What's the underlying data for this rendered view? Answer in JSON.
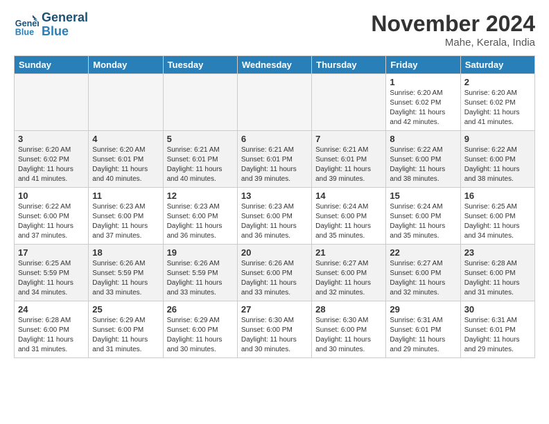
{
  "logo": {
    "line1": "General",
    "line2": "Blue"
  },
  "title": "November 2024",
  "location": "Mahe, Kerala, India",
  "days_of_week": [
    "Sunday",
    "Monday",
    "Tuesday",
    "Wednesday",
    "Thursday",
    "Friday",
    "Saturday"
  ],
  "weeks": [
    {
      "shaded": false,
      "days": [
        {
          "num": "",
          "detail": ""
        },
        {
          "num": "",
          "detail": ""
        },
        {
          "num": "",
          "detail": ""
        },
        {
          "num": "",
          "detail": ""
        },
        {
          "num": "",
          "detail": ""
        },
        {
          "num": "1",
          "detail": "Sunrise: 6:20 AM\nSunset: 6:02 PM\nDaylight: 11 hours\nand 42 minutes."
        },
        {
          "num": "2",
          "detail": "Sunrise: 6:20 AM\nSunset: 6:02 PM\nDaylight: 11 hours\nand 41 minutes."
        }
      ]
    },
    {
      "shaded": true,
      "days": [
        {
          "num": "3",
          "detail": "Sunrise: 6:20 AM\nSunset: 6:02 PM\nDaylight: 11 hours\nand 41 minutes."
        },
        {
          "num": "4",
          "detail": "Sunrise: 6:20 AM\nSunset: 6:01 PM\nDaylight: 11 hours\nand 40 minutes."
        },
        {
          "num": "5",
          "detail": "Sunrise: 6:21 AM\nSunset: 6:01 PM\nDaylight: 11 hours\nand 40 minutes."
        },
        {
          "num": "6",
          "detail": "Sunrise: 6:21 AM\nSunset: 6:01 PM\nDaylight: 11 hours\nand 39 minutes."
        },
        {
          "num": "7",
          "detail": "Sunrise: 6:21 AM\nSunset: 6:01 PM\nDaylight: 11 hours\nand 39 minutes."
        },
        {
          "num": "8",
          "detail": "Sunrise: 6:22 AM\nSunset: 6:00 PM\nDaylight: 11 hours\nand 38 minutes."
        },
        {
          "num": "9",
          "detail": "Sunrise: 6:22 AM\nSunset: 6:00 PM\nDaylight: 11 hours\nand 38 minutes."
        }
      ]
    },
    {
      "shaded": false,
      "days": [
        {
          "num": "10",
          "detail": "Sunrise: 6:22 AM\nSunset: 6:00 PM\nDaylight: 11 hours\nand 37 minutes."
        },
        {
          "num": "11",
          "detail": "Sunrise: 6:23 AM\nSunset: 6:00 PM\nDaylight: 11 hours\nand 37 minutes."
        },
        {
          "num": "12",
          "detail": "Sunrise: 6:23 AM\nSunset: 6:00 PM\nDaylight: 11 hours\nand 36 minutes."
        },
        {
          "num": "13",
          "detail": "Sunrise: 6:23 AM\nSunset: 6:00 PM\nDaylight: 11 hours\nand 36 minutes."
        },
        {
          "num": "14",
          "detail": "Sunrise: 6:24 AM\nSunset: 6:00 PM\nDaylight: 11 hours\nand 35 minutes."
        },
        {
          "num": "15",
          "detail": "Sunrise: 6:24 AM\nSunset: 6:00 PM\nDaylight: 11 hours\nand 35 minutes."
        },
        {
          "num": "16",
          "detail": "Sunrise: 6:25 AM\nSunset: 6:00 PM\nDaylight: 11 hours\nand 34 minutes."
        }
      ]
    },
    {
      "shaded": true,
      "days": [
        {
          "num": "17",
          "detail": "Sunrise: 6:25 AM\nSunset: 5:59 PM\nDaylight: 11 hours\nand 34 minutes."
        },
        {
          "num": "18",
          "detail": "Sunrise: 6:26 AM\nSunset: 5:59 PM\nDaylight: 11 hours\nand 33 minutes."
        },
        {
          "num": "19",
          "detail": "Sunrise: 6:26 AM\nSunset: 5:59 PM\nDaylight: 11 hours\nand 33 minutes."
        },
        {
          "num": "20",
          "detail": "Sunrise: 6:26 AM\nSunset: 6:00 PM\nDaylight: 11 hours\nand 33 minutes."
        },
        {
          "num": "21",
          "detail": "Sunrise: 6:27 AM\nSunset: 6:00 PM\nDaylight: 11 hours\nand 32 minutes."
        },
        {
          "num": "22",
          "detail": "Sunrise: 6:27 AM\nSunset: 6:00 PM\nDaylight: 11 hours\nand 32 minutes."
        },
        {
          "num": "23",
          "detail": "Sunrise: 6:28 AM\nSunset: 6:00 PM\nDaylight: 11 hours\nand 31 minutes."
        }
      ]
    },
    {
      "shaded": false,
      "days": [
        {
          "num": "24",
          "detail": "Sunrise: 6:28 AM\nSunset: 6:00 PM\nDaylight: 11 hours\nand 31 minutes."
        },
        {
          "num": "25",
          "detail": "Sunrise: 6:29 AM\nSunset: 6:00 PM\nDaylight: 11 hours\nand 31 minutes."
        },
        {
          "num": "26",
          "detail": "Sunrise: 6:29 AM\nSunset: 6:00 PM\nDaylight: 11 hours\nand 30 minutes."
        },
        {
          "num": "27",
          "detail": "Sunrise: 6:30 AM\nSunset: 6:00 PM\nDaylight: 11 hours\nand 30 minutes."
        },
        {
          "num": "28",
          "detail": "Sunrise: 6:30 AM\nSunset: 6:00 PM\nDaylight: 11 hours\nand 30 minutes."
        },
        {
          "num": "29",
          "detail": "Sunrise: 6:31 AM\nSunset: 6:01 PM\nDaylight: 11 hours\nand 29 minutes."
        },
        {
          "num": "30",
          "detail": "Sunrise: 6:31 AM\nSunset: 6:01 PM\nDaylight: 11 hours\nand 29 minutes."
        }
      ]
    }
  ]
}
